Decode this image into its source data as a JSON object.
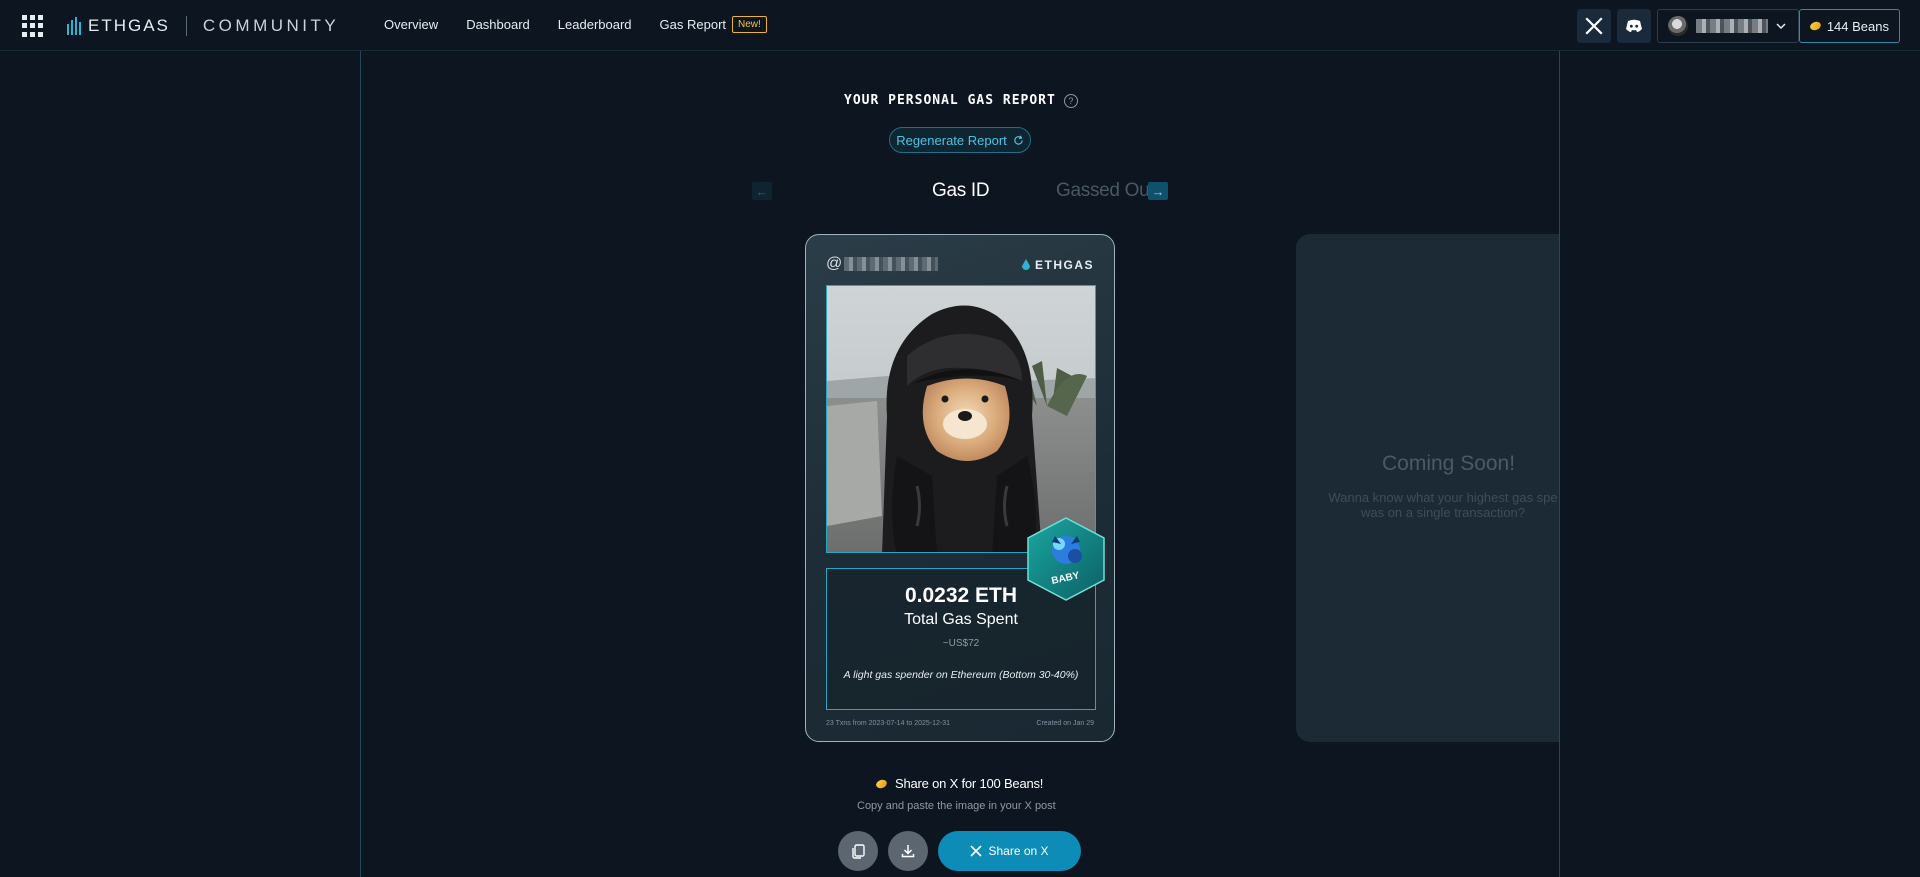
{
  "brand": {
    "name": "ETHGAS",
    "section": "COMMUNITY"
  },
  "nav": {
    "items": [
      {
        "label": "Overview"
      },
      {
        "label": "Dashboard"
      },
      {
        "label": "Leaderboard"
      },
      {
        "label": "Gas Report",
        "badge": "New!"
      }
    ]
  },
  "account": {
    "beans_label": "144 Beans"
  },
  "report": {
    "title": "YOUR PERSONAL GAS REPORT",
    "help": "?",
    "regenerate_label": "Regenerate Report",
    "tabs": [
      "Gas ID",
      "Gassed Out"
    ]
  },
  "card": {
    "handle_prefix": "@",
    "brand": "ETHGAS",
    "badge_label": "BABY",
    "eth_amount": "0.0232 ETH",
    "total_label": "Total Gas Spent",
    "usd_value": "~US$72",
    "tier_description": "A light gas spender on Ethereum (Bottom 30-40%)",
    "footer_left": "23 Txns from 2023-07-14 to 2025-12-31",
    "footer_right": "Created on Jan 29"
  },
  "coming_soon": {
    "title": "Coming Soon!",
    "line1": "Wanna know what your highest gas spe",
    "line2": "was on a single transaction?"
  },
  "share": {
    "title": "Share on X for 100 Beans!",
    "subtitle": "Copy and paste the image in your X post",
    "button_label": "Share on X"
  },
  "colors": {
    "accent": "#0e8cb8",
    "badge": "#e8b62f",
    "background": "#0c1520"
  }
}
